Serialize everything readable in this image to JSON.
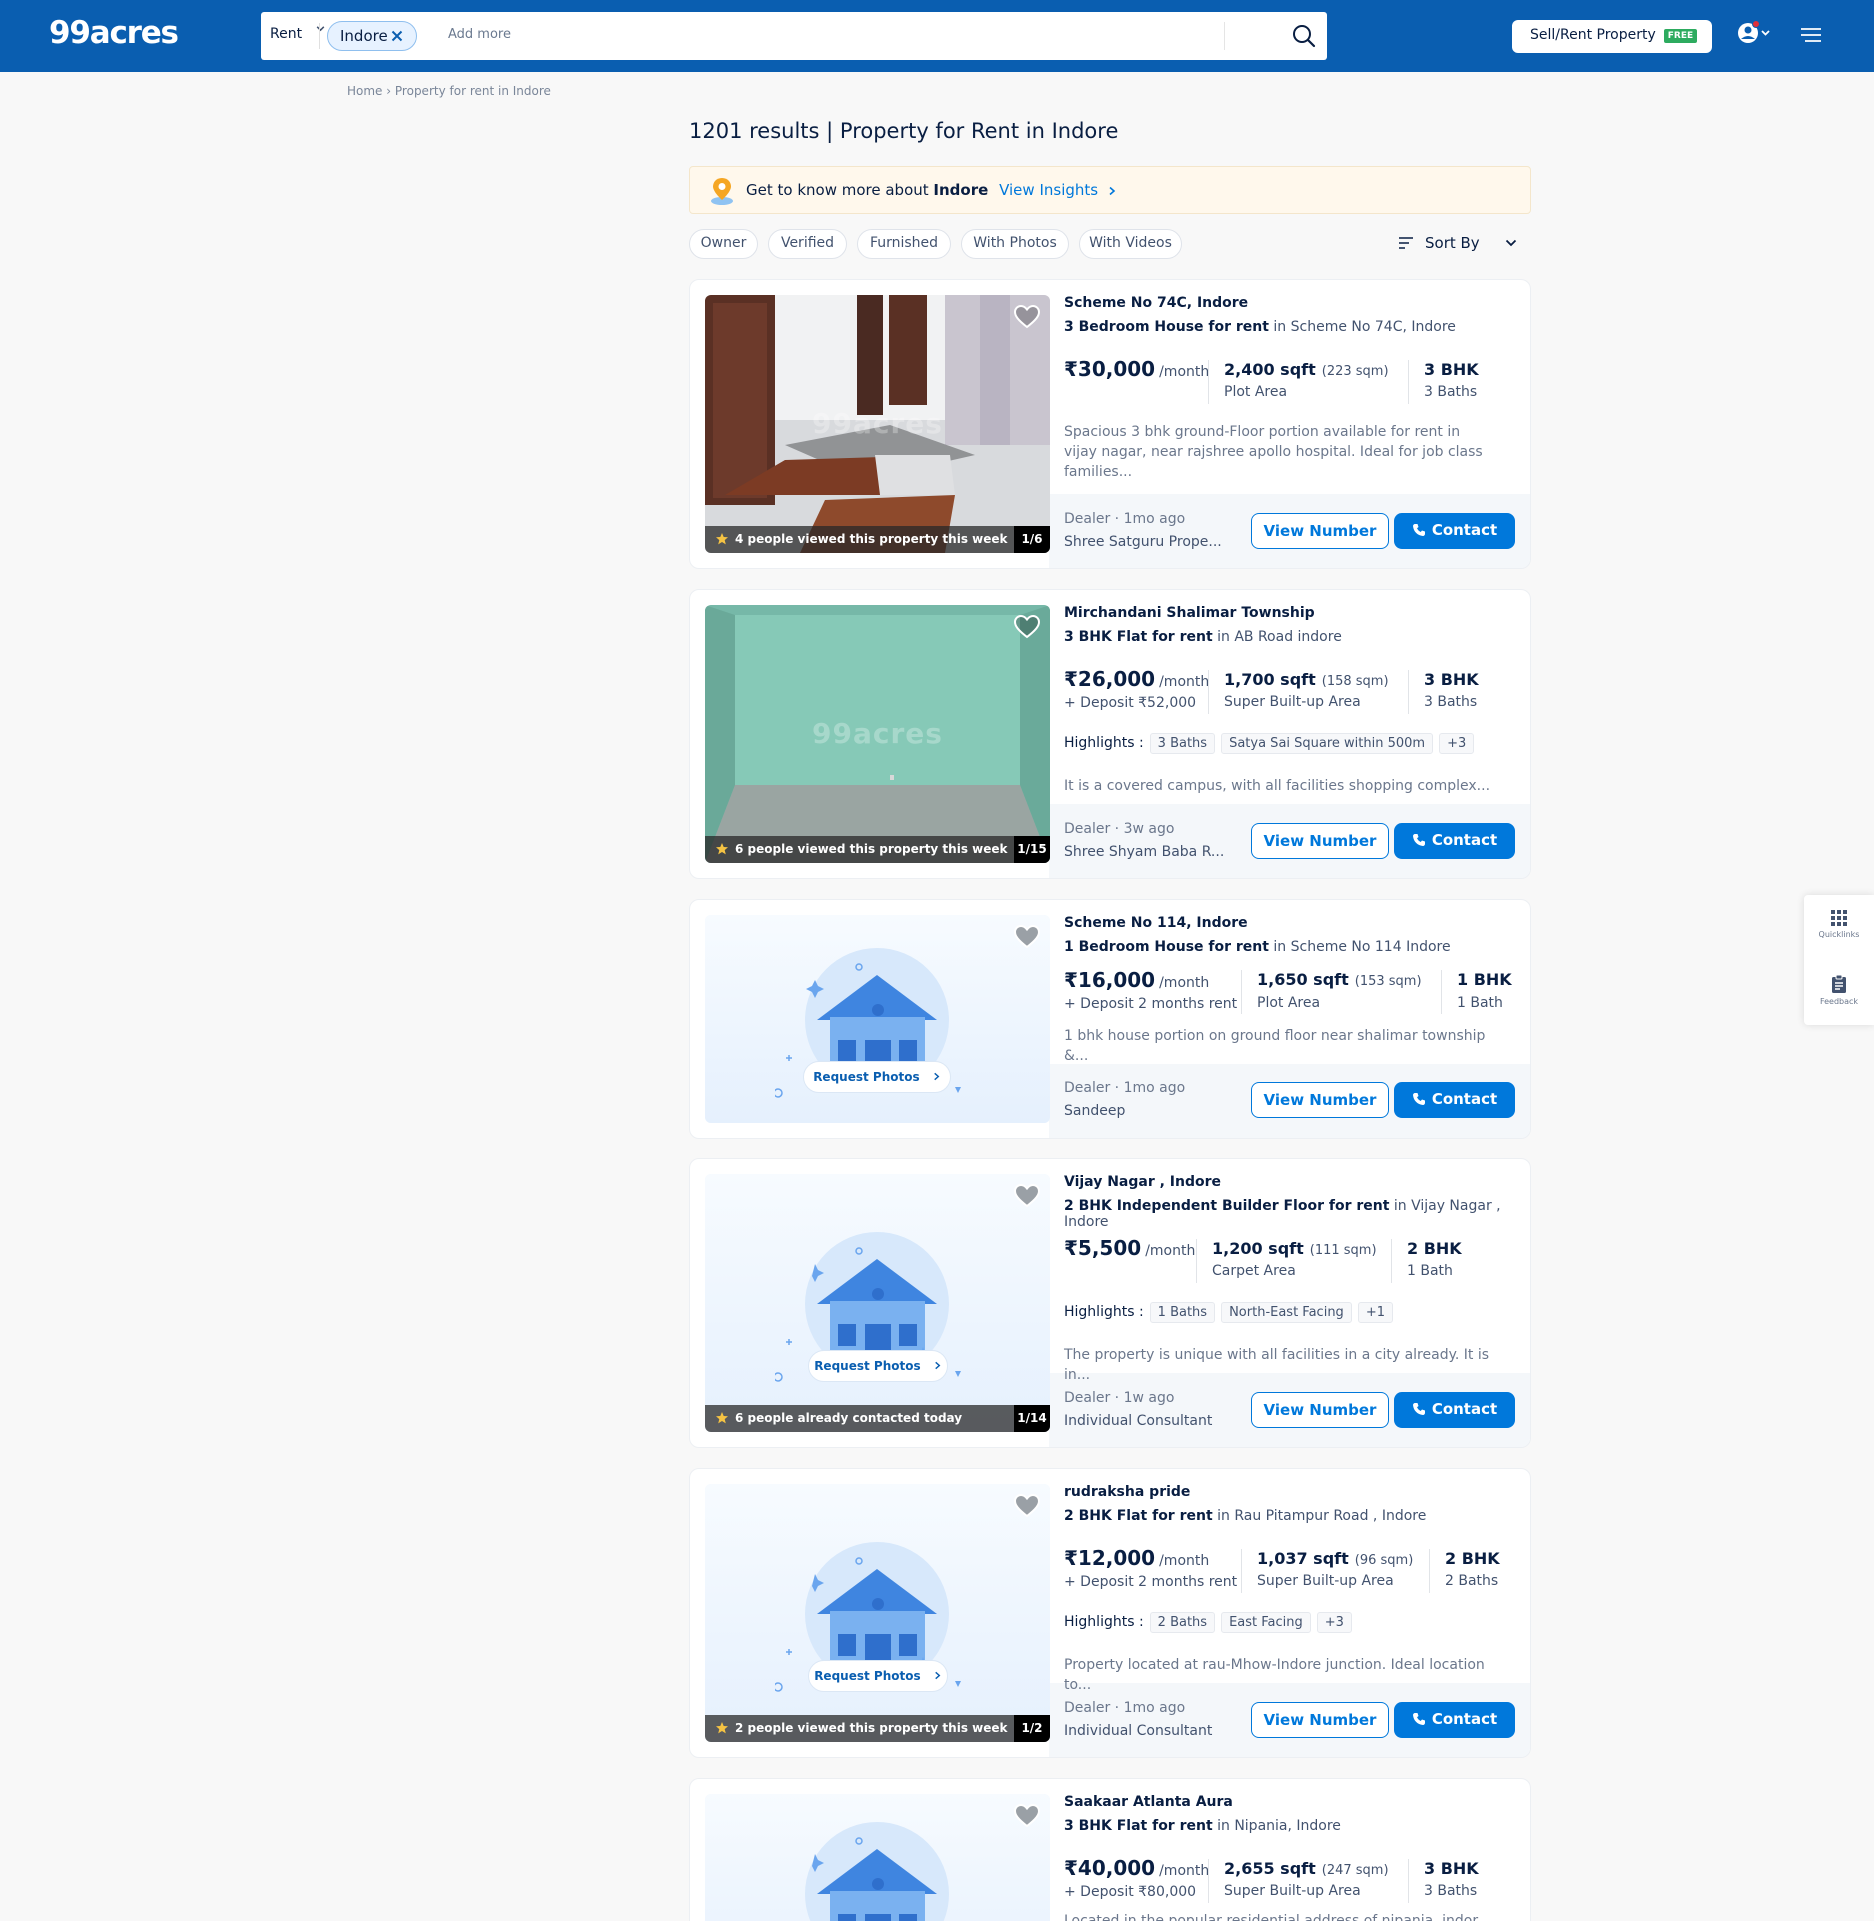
{
  "header": {
    "logo": "99acres",
    "search": {
      "mode": "Rent",
      "city_chip": "Indore",
      "placeholder": "Add more"
    },
    "sell_button": "Sell/Rent Property",
    "free_badge": "FREE"
  },
  "breadcrumb": {
    "home": "Home",
    "separator": "›",
    "current": "Property for rent in Indore"
  },
  "page_title": "1201 results | Property for Rent in Indore",
  "insights": {
    "prefix": "Get to know more about",
    "city": "Indore",
    "link": "View Insights"
  },
  "filters": [
    "Owner",
    "Verified",
    "Furnished",
    "With Photos",
    "With Videos"
  ],
  "sort_label": "Sort By",
  "listings": [
    {
      "location": "Scheme No 74C, Indore",
      "type_bold": "3 Bedroom House for rent",
      "type_rest": " in Scheme No 74C, Indore",
      "price": "₹30,000",
      "per": "/month",
      "area": "2,400 sqft",
      "area_sqm": "(223 sqm)",
      "area_type": "Plot Area",
      "bhk": "3 BHK",
      "baths": "3 Baths",
      "description": "Spacious 3 bhk ground-Floor portion available for rent in vijay nagar, near rajshree apollo hospital. Ideal for job class families...",
      "dealer": "Dealer",
      "posted": "1mo ago",
      "name": "Shree Satguru Prope...",
      "views": "4 people viewed this property this week",
      "photo_count": "1/6",
      "watermark": "99acres"
    },
    {
      "location": "Mirchandani Shalimar Township",
      "type_bold": "3 BHK Flat for rent",
      "type_rest": " in AB Road indore",
      "price": "₹26,000",
      "per": "/month",
      "deposit": "+ Deposit ₹52,000",
      "area": "1,700 sqft",
      "area_sqm": "(158 sqm)",
      "area_type": "Super Built-up Area",
      "bhk": "3 BHK",
      "baths": "3 Baths",
      "highlights_label": "Highlights :",
      "highlights": [
        "3 Baths",
        "Satya Sai Square within 500m",
        "+3"
      ],
      "description": "It is a covered campus, with all facilities shopping complex...",
      "dealer": "Dealer",
      "posted": "3w ago",
      "name": "Shree Shyam Baba R...",
      "views": "6 people viewed this property this week",
      "photo_count": "1/15",
      "watermark": "99acres"
    },
    {
      "location": "Scheme No 114, Indore",
      "type_bold": "1 Bedroom House for rent",
      "type_rest": " in Scheme No 114 Indore",
      "price": "₹16,000",
      "per": "/month",
      "deposit": "+ Deposit 2 months rent",
      "area": "1,650 sqft",
      "area_sqm": "(153 sqm)",
      "area_type": "Plot Area",
      "bhk": "1 BHK",
      "baths": "1 Bath",
      "description": "1 bhk house portion on ground floor near shalimar township &...",
      "dealer": "Dealer",
      "posted": "1mo ago",
      "name": "Sandeep",
      "request": "Request Photos"
    },
    {
      "location": "Vijay Nagar , Indore",
      "type_bold": "2 BHK Independent Builder Floor for rent",
      "type_rest": " in Vijay Nagar , Indore",
      "price": "₹5,500",
      "per": "/month",
      "area": "1,200 sqft",
      "area_sqm": "(111 sqm)",
      "area_type": "Carpet Area",
      "bhk": "2 BHK",
      "baths": "1 Bath",
      "highlights_label": "Highlights :",
      "highlights": [
        "1 Baths",
        "North-East Facing",
        "+1"
      ],
      "description": "The property is unique with all facilities in a city already. It is in...",
      "dealer": "Dealer",
      "posted": "1w ago",
      "name": "Individual Consultant",
      "views": "6 people already contacted today",
      "photo_count": "1/14",
      "request": "Request Photos"
    },
    {
      "location": "rudraksha pride",
      "type_bold": "2 BHK Flat for rent",
      "type_rest": " in Rau Pitampur Road , Indore",
      "price": "₹12,000",
      "per": "/month",
      "deposit": "+ Deposit 2 months rent",
      "area": "1,037 sqft",
      "area_sqm": "(96 sqm)",
      "area_type": "Super Built-up Area",
      "bhk": "2 BHK",
      "baths": "2 Baths",
      "highlights_label": "Highlights :",
      "highlights": [
        "2 Baths",
        "East Facing",
        "+3"
      ],
      "description": "Property located at rau-Mhow-Indore junction. Ideal location to...",
      "dealer": "Dealer",
      "posted": "1mo ago",
      "name": "Individual Consultant",
      "views": "2 people viewed this property this week",
      "photo_count": "1/2",
      "request": "Request Photos"
    },
    {
      "location": "Saakaar Atlanta Aura",
      "type_bold": "3 BHK Flat for rent",
      "type_rest": " in Nipania, Indore",
      "price": "₹40,000",
      "per": "/month",
      "deposit": "+ Deposit ₹80,000",
      "area": "2,655 sqft",
      "area_sqm": "(247 sqm)",
      "area_type": "Super Built-up Area",
      "bhk": "3 BHK",
      "baths": "3 Baths",
      "description": "Located in the popular residential address of nipania, indore,..."
    }
  ],
  "buttons": {
    "view_number": "View Number",
    "contact": "Contact"
  },
  "side_widget": {
    "quicklinks": "Quicklinks",
    "feedback": "Feedback"
  },
  "colors": {
    "header_bg": "#0a5eb0",
    "accent": "#0078db",
    "insight_bg": "#fff8ec",
    "free_badge": "#2dab5f"
  }
}
